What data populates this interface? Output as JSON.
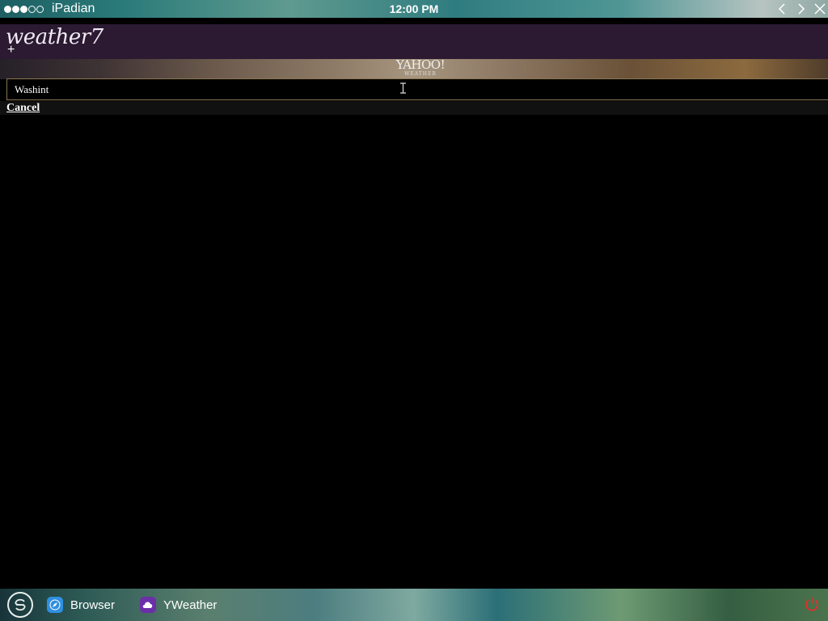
{
  "statusbar": {
    "carrier": "iPadian",
    "time": "12:00 PM"
  },
  "app": {
    "logo": "weather7",
    "add_label": "+"
  },
  "banner": {
    "brand": "YAHOO!",
    "sub": "WEATHER"
  },
  "search": {
    "value": "Washint"
  },
  "cancel_label": "Cancel",
  "taskbar": {
    "items": [
      {
        "label": "Browser",
        "icon": "compass-icon"
      },
      {
        "label": "YWeather",
        "icon": "cloud-icon"
      }
    ]
  },
  "colors": {
    "header_bg": "#2b1a32",
    "power": "#e0302a",
    "browser_icon": "#2f8fe0",
    "weather_icon": "#6b2fa8"
  }
}
